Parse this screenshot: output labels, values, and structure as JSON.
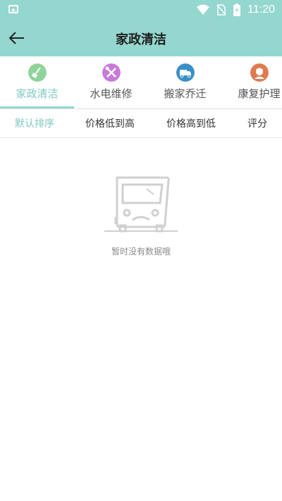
{
  "status_bar": {
    "time": "11:20"
  },
  "header": {
    "title": "家政清洁"
  },
  "categories": [
    {
      "label": "家政清洁",
      "icon": "broom-icon",
      "color": "#8ed49a"
    },
    {
      "label": "水电维修",
      "icon": "tools-icon",
      "color": "#c77bd8"
    },
    {
      "label": "搬家乔迁",
      "icon": "truck-icon",
      "color": "#3a8fc7"
    },
    {
      "label": "康复护理",
      "icon": "nurse-icon",
      "color": "#e07a4f"
    }
  ],
  "active_category": "家政清洁",
  "sort_options": [
    "默认排序",
    "价格低到高",
    "价格高到低",
    "评分"
  ],
  "active_sort": "默认排序",
  "empty_state": {
    "text": "暂时没有数据哦",
    "icon": "empty-bus-icon"
  },
  "colors": {
    "primary": "#93d7cf",
    "accent_text": "#7fc8bf"
  }
}
